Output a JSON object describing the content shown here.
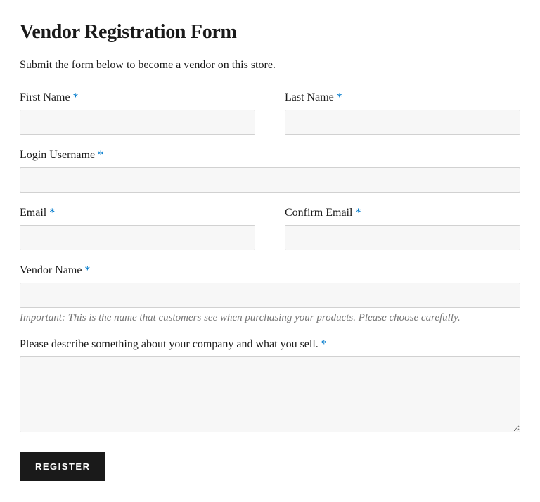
{
  "title": "Vendor Registration Form",
  "intro": "Submit the form below to become a vendor on this store.",
  "required_marker": "*",
  "fields": {
    "first_name": {
      "label": "First Name",
      "value": ""
    },
    "last_name": {
      "label": "Last Name",
      "value": ""
    },
    "login_username": {
      "label": "Login Username",
      "value": ""
    },
    "email": {
      "label": "Email",
      "value": ""
    },
    "confirm_email": {
      "label": "Confirm Email",
      "value": ""
    },
    "vendor_name": {
      "label": "Vendor Name",
      "value": "",
      "hint": "Important: This is the name that customers see when purchasing your products. Please choose carefully."
    },
    "description": {
      "label": "Please describe something about your company and what you sell.",
      "value": ""
    }
  },
  "submit_label": "Register"
}
